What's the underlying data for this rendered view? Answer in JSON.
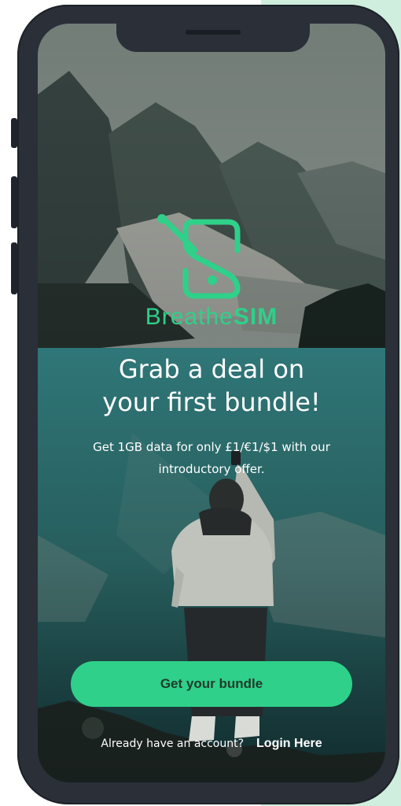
{
  "brand": {
    "name_light": "Breathe",
    "name_bold": "SIM",
    "icon": "sim-card-logo-icon",
    "accent_color": "#2fd089"
  },
  "hero": {
    "headline_line1": "Grab a deal on",
    "headline_line2": "your first bundle!",
    "subtext_line1": "Get 1GB data for only £1/€1/$1 with our",
    "subtext_line2": "introductory offer."
  },
  "actions": {
    "cta_label": "Get your bundle",
    "account_prompt": "Already have an account?",
    "login_label": "Login Here"
  }
}
